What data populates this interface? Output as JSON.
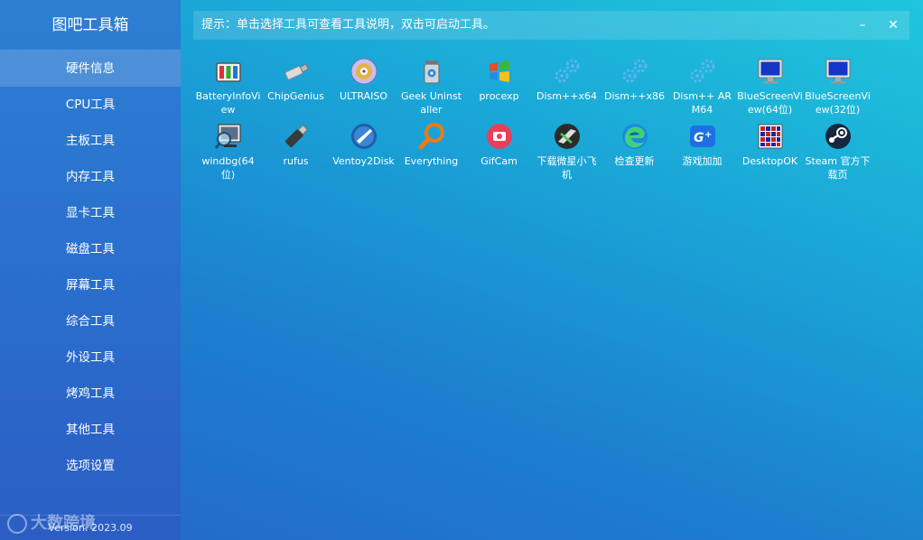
{
  "app": {
    "title": "图吧工具箱",
    "version": "Version: 2023.09"
  },
  "hint": {
    "text": "提示：单击选择工具可查看工具说明，双击可启动工具。",
    "minimize": "–",
    "close": "✕"
  },
  "sidebar": {
    "items": [
      {
        "label": "硬件信息",
        "active": true
      },
      {
        "label": "CPU工具"
      },
      {
        "label": "主板工具"
      },
      {
        "label": "内存工具"
      },
      {
        "label": "显卡工具"
      },
      {
        "label": "磁盘工具"
      },
      {
        "label": "屏幕工具"
      },
      {
        "label": "综合工具"
      },
      {
        "label": "外设工具"
      },
      {
        "label": "烤鸡工具"
      },
      {
        "label": "其他工具"
      },
      {
        "label": "选项设置"
      }
    ]
  },
  "tools": [
    {
      "label": "BatteryInfoView",
      "icon": "battery-icon"
    },
    {
      "label": "ChipGenius",
      "icon": "usb-drive-icon"
    },
    {
      "label": "ULTRAISO",
      "icon": "disc-icon"
    },
    {
      "label": "Geek Uninstaller",
      "icon": "trash-can-icon"
    },
    {
      "label": "procexp",
      "icon": "windows-logo-icon"
    },
    {
      "label": "Dism++x64",
      "icon": "gears-icon"
    },
    {
      "label": "Dism++x86",
      "icon": "gears-icon"
    },
    {
      "label": "Dism++ ARM64",
      "icon": "gears-icon"
    },
    {
      "label": "BlueScreenView(64位)",
      "icon": "monitor-icon"
    },
    {
      "label": "BlueScreenView(32位)",
      "icon": "monitor-icon"
    },
    {
      "label": "windbg(64位)",
      "icon": "debug-monitor-icon"
    },
    {
      "label": "rufus",
      "icon": "usb-stick-icon"
    },
    {
      "label": "Ventoy2Disk",
      "icon": "ventoy-icon"
    },
    {
      "label": "Everything",
      "icon": "magnifier-icon"
    },
    {
      "label": "GifCam",
      "icon": "camera-icon"
    },
    {
      "label": "下载微星小飞机",
      "icon": "afterburner-icon"
    },
    {
      "label": "检查更新",
      "icon": "edge-icon"
    },
    {
      "label": "游戏加加",
      "icon": "game-plus-icon"
    },
    {
      "label": "DesktopOK",
      "icon": "desktop-grid-icon"
    },
    {
      "label": "Steam 官方下载页",
      "icon": "steam-icon"
    }
  ],
  "watermark": "大数跨境"
}
